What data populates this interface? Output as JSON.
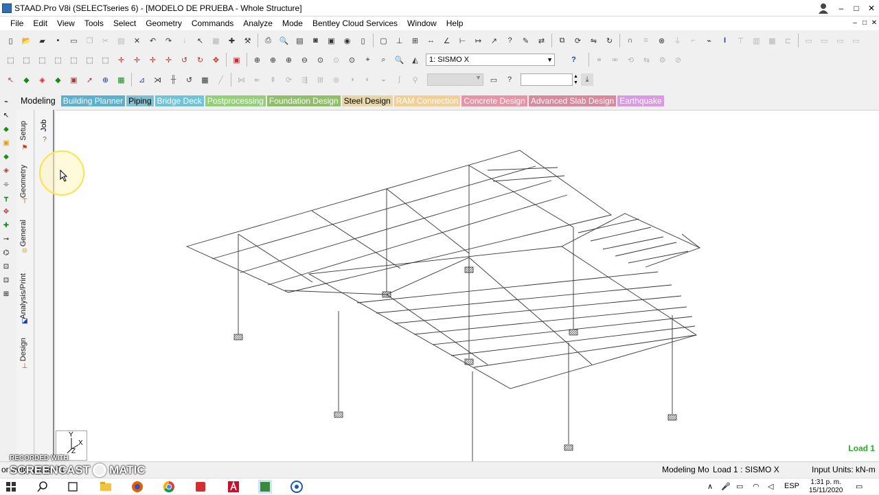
{
  "window": {
    "title": "STAAD.Pro V8i (SELECTseries 6) - [MODELO DE PRUEBA - Whole Structure]",
    "controls": [
      "–",
      "□",
      "✕"
    ]
  },
  "menu": {
    "items": [
      "File",
      "Edit",
      "View",
      "Tools",
      "Select",
      "Geometry",
      "Commands",
      "Analyze",
      "Mode",
      "Bentley Cloud Services",
      "Window",
      "Help"
    ]
  },
  "toolbar": {
    "load_case_selected": "1: SISMO X"
  },
  "workflow": {
    "tabs": [
      {
        "label": "Modeling",
        "color": "transparent"
      },
      {
        "label": "Building Planner",
        "color": "#5ab0cf"
      },
      {
        "label": "Piping",
        "color": "#7fbfd0"
      },
      {
        "label": "Bridge Deck",
        "color": "#6fc4d8"
      },
      {
        "label": "Postprocessing",
        "color": "#95cf7a"
      },
      {
        "label": "Foundation Design",
        "color": "#8fbf6a"
      },
      {
        "label": "Steel Design",
        "color": "#e6d6a8"
      },
      {
        "label": "RAM Connection",
        "color": "#f3cf96"
      },
      {
        "label": "Concrete Design",
        "color": "#e994a6"
      },
      {
        "label": "Advanced Slab Design",
        "color": "#d9889e"
      },
      {
        "label": "Earthquake",
        "color": "#d99ae2"
      }
    ]
  },
  "side_tabs": {
    "items": [
      "Setup",
      "Geometry",
      "General",
      "Analysis/Print",
      "Design"
    ],
    "job_tab": "Job"
  },
  "axis": {
    "y": "Y",
    "x": "X",
    "z": "Z"
  },
  "viewport": {
    "load_label": "Load 1"
  },
  "statusbar": {
    "help": "or Help, press F1",
    "mode": "Modeling Mo",
    "load": "Load 1 : SISMO X",
    "units": "Input Units:  kN-m"
  },
  "watermark": {
    "line1": "RECORDED WITH",
    "line2a": "SCREENCAST",
    "line2b": "MATIC"
  },
  "taskbar": {
    "lang": "ESP",
    "time": "1:31 p. m.",
    "date": "15/11/2020"
  },
  "colors": {
    "load_label": "#22b022",
    "support_hatch": "#555555"
  }
}
